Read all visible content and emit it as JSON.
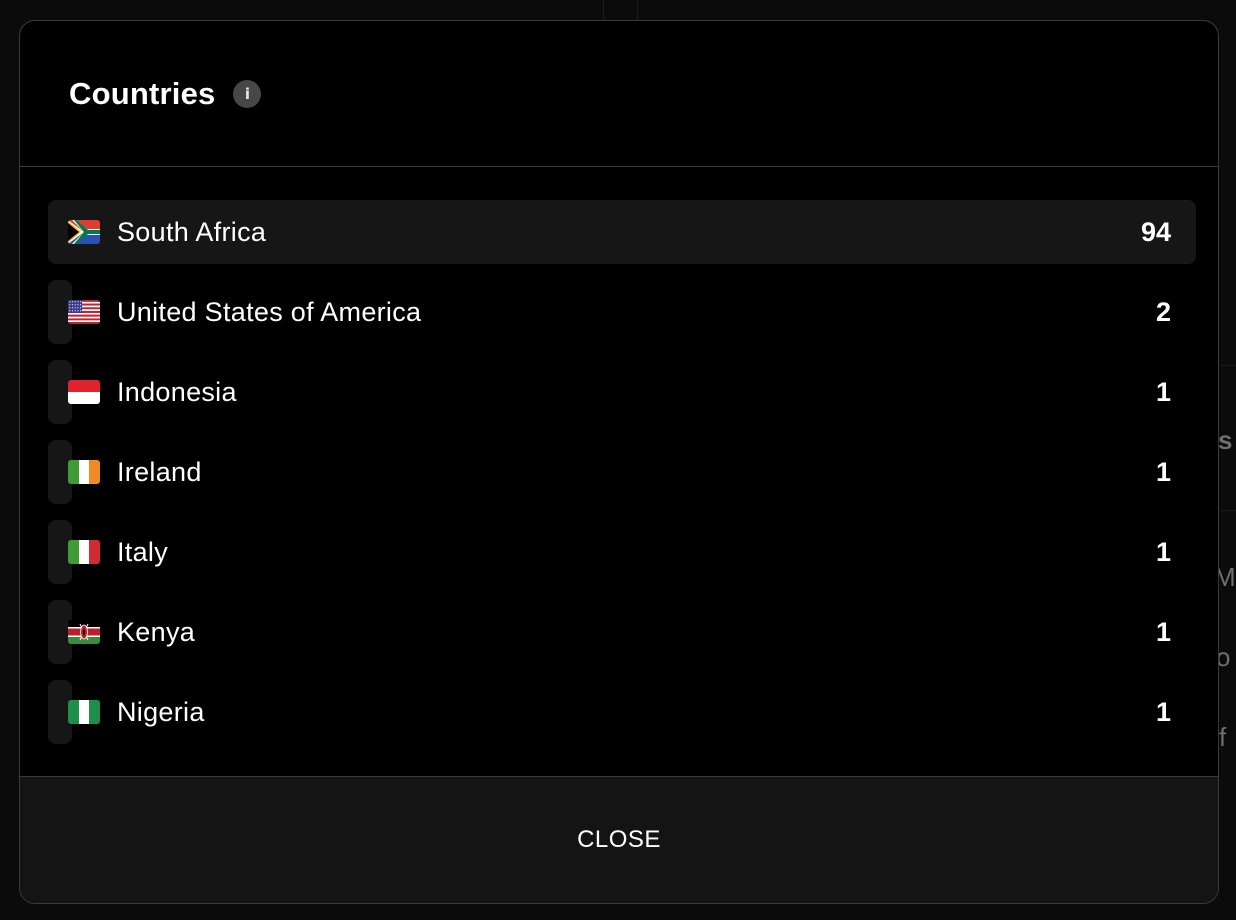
{
  "modal": {
    "title": "Countries",
    "info_icon": "info-icon",
    "close_label": "CLOSE"
  },
  "countries": [
    {
      "name": "South Africa",
      "count": "94",
      "value": 94,
      "flag": "flag-south-africa"
    },
    {
      "name": "United States of America",
      "count": "2",
      "value": 2,
      "flag": "flag-usa"
    },
    {
      "name": "Indonesia",
      "count": "1",
      "value": 1,
      "flag": "flag-indonesia"
    },
    {
      "name": "Ireland",
      "count": "1",
      "value": 1,
      "flag": "flag-ireland"
    },
    {
      "name": "Italy",
      "count": "1",
      "value": 1,
      "flag": "flag-italy"
    },
    {
      "name": "Kenya",
      "count": "1",
      "value": 1,
      "flag": "flag-kenya"
    },
    {
      "name": "Nigeria",
      "count": "1",
      "value": 1,
      "flag": "flag-nigeria"
    }
  ],
  "colors": {
    "modal_background": "#000000",
    "row_bar": "#161616",
    "footer_background": "#141414",
    "border": "#3a3a3a"
  }
}
